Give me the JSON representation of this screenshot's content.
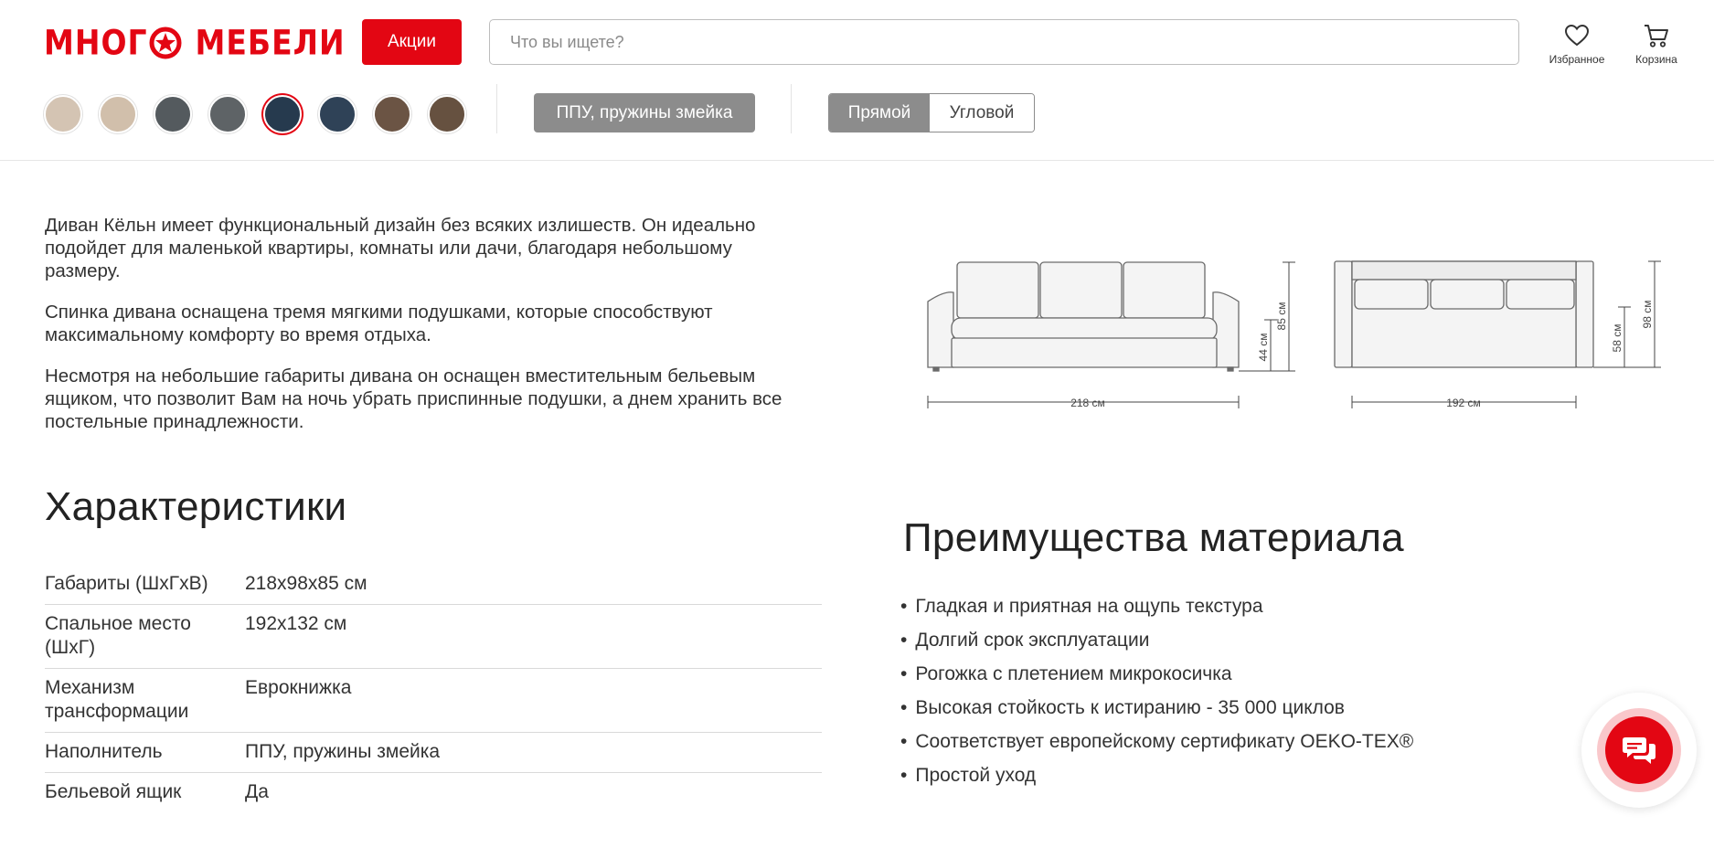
{
  "header": {
    "logo": {
      "word1": "МНОГ",
      "word1_end": "",
      "word2": "МЕБЕЛИ"
    },
    "promo_label": "Акции",
    "search_placeholder": "Что вы ищете?",
    "favorites_label": "Избранное",
    "cart_label": "Корзина",
    "brand_color": "#e30613"
  },
  "options": {
    "colors": [
      {
        "hex": "#d4c4b3"
      },
      {
        "hex": "#d1bfab"
      },
      {
        "hex": "#545a5e"
      },
      {
        "hex": "#5e6366"
      },
      {
        "hex": "#263a4e",
        "selected": true
      },
      {
        "hex": "#2f4257"
      },
      {
        "hex": "#6b5444"
      },
      {
        "hex": "#665140"
      }
    ],
    "filling_label": "ППУ, пружины змейка",
    "shape": {
      "straight": "Прямой",
      "corner": "Угловой",
      "selected": "Прямой"
    }
  },
  "description": {
    "p1": "Диван Кёльн имеет функциональный дизайн без всяких излишеств. Он идеально подойдет для маленькой квартиры, комнаты или дачи, благодаря небольшому размеру.",
    "p2": "Спинка дивана оснащена тремя мягкими подушками, которые способствуют максимальному комфорту во время отдыха.",
    "p3": "Несмотря на небольшие габариты дивана он оснащен вместительным бельевым ящиком, что позволит Вам на ночь убрать приспинные подушки, а днем хранить все постельные принадлежности."
  },
  "scheme": {
    "front_width": "218 см",
    "front_height": "85 см",
    "front_seat_height": "44 см",
    "bed_width": "192 см",
    "bed_depth": "98 см",
    "bed_seat_depth": "58 см"
  },
  "specs": {
    "title": "Характеристики",
    "rows": [
      {
        "key": "Габариты (ШхГхВ)",
        "value": "218x98x85 см"
      },
      {
        "key": "Спальное место (ШхГ)",
        "value": "192x132 см"
      },
      {
        "key": "Механизм трансформации",
        "value": "Еврокнижка"
      },
      {
        "key": "Наполнитель",
        "value": "ППУ, пружины змейка"
      },
      {
        "key": "Бельевой ящик",
        "value": "Да"
      }
    ]
  },
  "advantages": {
    "title": "Преимущества материала",
    "items": [
      "Гладкая и приятная на ощупь текстура",
      "Долгий срок эксплуатации",
      "Рогожка с плетением микрокосичка",
      "Высокая стойкость к истиранию - 35 000 циклов",
      "Соответствует европейскому сертификату OEKO-TEX®",
      "Простой уход"
    ]
  }
}
